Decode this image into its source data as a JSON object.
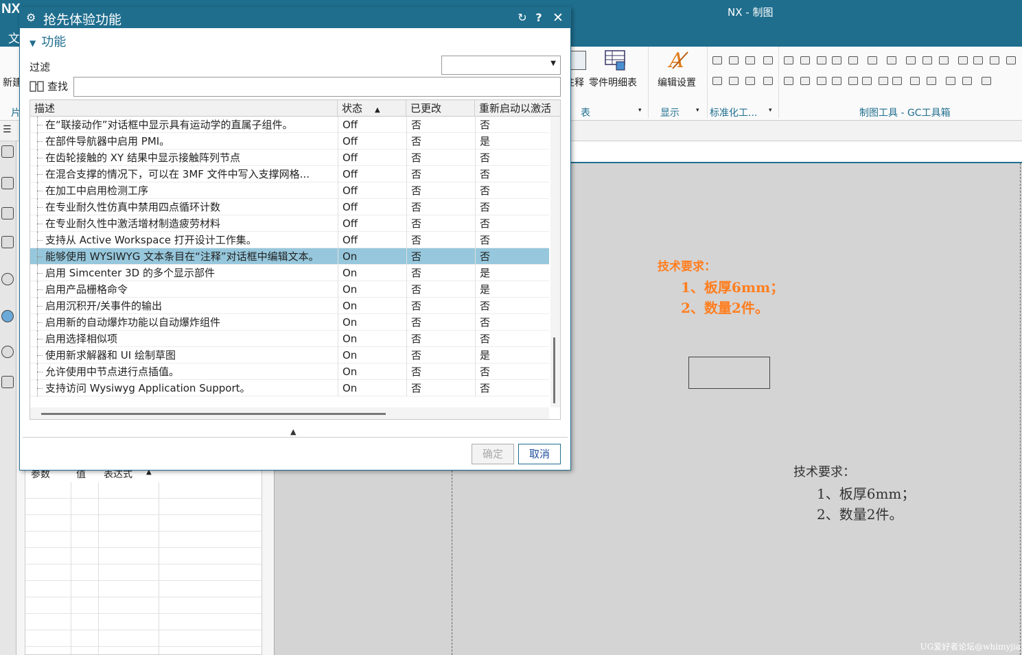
{
  "app": {
    "logo": "NX",
    "title": "NX - 制图",
    "menu_file": "文"
  },
  "ribbon": {
    "left_cut_label": "新建",
    "left_cut_group": "片",
    "annot_label": "注释",
    "parts_list_label": "零件明细表",
    "edit_settings_label": "编辑设置",
    "groups": {
      "table": "表",
      "display": "显示",
      "standard": "标准化工...",
      "drafting_tools": "制图工具 - GC工具箱"
    }
  },
  "subbar": {
    "icon_text": "☰"
  },
  "param_table": {
    "headers": [
      "参数",
      "值",
      "表达式"
    ]
  },
  "dialog": {
    "title": "抢先体验功能",
    "section": "功能",
    "filter_label": "过滤",
    "filter_value": "",
    "find_label": "查找",
    "find_value": "",
    "columns": [
      "描述",
      "状态",
      "已更改",
      "重新启动以激活"
    ],
    "rows": [
      {
        "desc": "在“联接动作”对话框中显示具有运动学的直属子组件。",
        "status": "Off",
        "changed": "否",
        "restart": "否"
      },
      {
        "desc": "在部件导航器中启用 PMI。",
        "status": "Off",
        "changed": "否",
        "restart": "是"
      },
      {
        "desc": "在齿轮接触的 XY 结果中显示接触阵列节点",
        "status": "Off",
        "changed": "否",
        "restart": "否"
      },
      {
        "desc": "在混合支撑的情况下，可以在 3MF 文件中写入支撑网格...",
        "status": "Off",
        "changed": "否",
        "restart": "否"
      },
      {
        "desc": "在加工中启用检测工序",
        "status": "Off",
        "changed": "否",
        "restart": "否"
      },
      {
        "desc": "在专业耐久性仿真中禁用四点循环计数",
        "status": "Off",
        "changed": "否",
        "restart": "否"
      },
      {
        "desc": "在专业耐久性中激活增材制造疲劳材料",
        "status": "Off",
        "changed": "否",
        "restart": "否"
      },
      {
        "desc": "支持从 Active Workspace 打开设计工作集。",
        "status": "Off",
        "changed": "否",
        "restart": "否"
      },
      {
        "desc": "能够使用 WYSIWYG 文本条目在“注释”对话框中编辑文本。",
        "status": "On",
        "changed": "否",
        "restart": "否"
      },
      {
        "desc": "启用 Simcenter 3D 的多个显示部件",
        "status": "On",
        "changed": "否",
        "restart": "是"
      },
      {
        "desc": "启用产品栅格命令",
        "status": "On",
        "changed": "否",
        "restart": "是"
      },
      {
        "desc": "启用沉积开/关事件的输出",
        "status": "On",
        "changed": "否",
        "restart": "否"
      },
      {
        "desc": "启用新的自动爆炸功能以自动爆炸组件",
        "status": "On",
        "changed": "否",
        "restart": "否"
      },
      {
        "desc": "启用选择相似项",
        "status": "On",
        "changed": "否",
        "restart": "否"
      },
      {
        "desc": "使用新求解器和 UI 绘制草图",
        "status": "On",
        "changed": "否",
        "restart": "是"
      },
      {
        "desc": "允许使用中节点进行点插值。",
        "status": "On",
        "changed": "否",
        "restart": "否"
      },
      {
        "desc": "支持访问 Wysiwyg Application Support。",
        "status": "On",
        "changed": "否",
        "restart": "否"
      }
    ],
    "selected_row": 8,
    "ok_label": "确定",
    "cancel_label": "取消"
  },
  "drawing": {
    "anno_orange": [
      "技术要求：",
      "1、板厚6mm；",
      "2、数量2件。"
    ],
    "anno_dark": [
      "技术要求：",
      "1、板厚6mm；",
      "2、数量2件。"
    ],
    "watermark": "UG爱好者论坛@whimyjia"
  },
  "colors": {
    "accent": "#1f6e8e",
    "selection": "#96c7dc",
    "annotation_orange": "#ff7e1f"
  }
}
